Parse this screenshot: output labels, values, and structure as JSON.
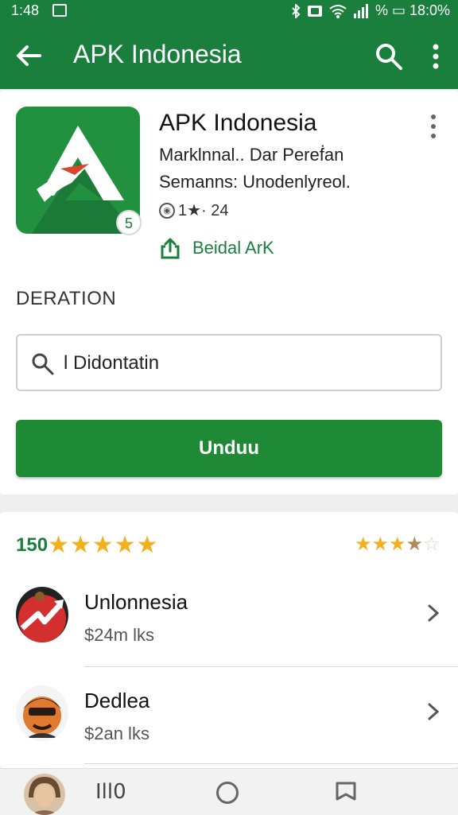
{
  "status_bar": {
    "time": "1:48",
    "right_text": "% ▭ 18:0%",
    "icons": [
      "image-icon",
      "bluetooth-icon",
      "nfc-icon",
      "wifi-icon",
      "signal-icon",
      "battery-icon"
    ]
  },
  "app_bar": {
    "title": "APK Indonesia",
    "back_icon": "arrow-left-icon",
    "search_icon": "search-icon",
    "more_icon": "more-vert-icon",
    "color": "#1a7f3c"
  },
  "app_card": {
    "name": "APK Indonesia",
    "subtitle_line1": "Marklnnal.. Dar Pereḟan",
    "subtitle_line2": "Semanns: Unodenlyreol.",
    "meta_rating": "1★· 24",
    "badge": "5",
    "share_label": "Beidal ArK",
    "section_label": "DERATION",
    "search_value": "l Didontatin",
    "download_label": "Unduu"
  },
  "ratings": {
    "count": "150",
    "left_stars": "★★★★★",
    "right_stars_full": "★★★",
    "right_stars_half": "★",
    "right_stars_empty": "☆"
  },
  "list": [
    {
      "name": "Unlonnesia",
      "desc": "$24m lks"
    },
    {
      "name": "Dedlea",
      "desc": "$2an lks"
    }
  ],
  "nav_bar": {
    "recent_label": "Ill0"
  },
  "colors": {
    "accent": "#1a7f3c",
    "button": "#1e8a35",
    "star": "#f2b01e"
  }
}
